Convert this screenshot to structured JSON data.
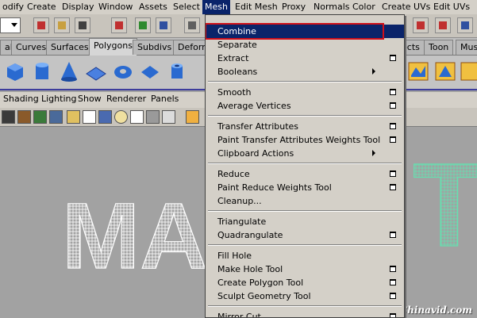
{
  "menubar": {
    "items": [
      "odify",
      "Create",
      "Display",
      "Window",
      "Assets",
      "Select",
      "Mesh",
      "Edit Mesh",
      "Proxy",
      "Normals",
      "Color",
      "Create UVs",
      "Edit UVs"
    ],
    "active_index": 6
  },
  "shelf_tabs": {
    "items": [
      "al",
      "Curves",
      "Surfaces",
      "Polygons",
      "Subdivs",
      "Deform",
      "ects",
      "Toon",
      "Mus"
    ],
    "active_index": 3
  },
  "panel_menu": {
    "items": [
      "Shading",
      "Lighting",
      "Show",
      "Renderer",
      "Panels"
    ]
  },
  "mesh_menu": {
    "items": [
      {
        "label": "Combine",
        "option": false,
        "submenu": false,
        "highlighted": true
      },
      {
        "label": "Separate",
        "option": false,
        "submenu": false
      },
      {
        "label": "Extract",
        "option": true,
        "submenu": false
      },
      {
        "label": "Booleans",
        "option": false,
        "submenu": true
      },
      {
        "separator": true
      },
      {
        "label": "Smooth",
        "option": true,
        "submenu": false
      },
      {
        "label": "Average Vertices",
        "option": true,
        "submenu": false
      },
      {
        "separator": true
      },
      {
        "label": "Transfer Attributes",
        "option": true,
        "submenu": false
      },
      {
        "label": "Paint Transfer Attributes Weights Tool",
        "option": true,
        "submenu": false
      },
      {
        "label": "Clipboard Actions",
        "option": false,
        "submenu": true
      },
      {
        "separator": true
      },
      {
        "label": "Reduce",
        "option": true,
        "submenu": false
      },
      {
        "label": "Paint Reduce Weights Tool",
        "option": true,
        "submenu": false
      },
      {
        "label": "Cleanup...",
        "option": false,
        "submenu": false
      },
      {
        "separator": true
      },
      {
        "label": "Triangulate",
        "option": false,
        "submenu": false
      },
      {
        "label": "Quadrangulate",
        "option": true,
        "submenu": false
      },
      {
        "separator": true
      },
      {
        "label": "Fill Hole",
        "option": false,
        "submenu": false
      },
      {
        "label": "Make Hole Tool",
        "option": true,
        "submenu": false
      },
      {
        "label": "Create Polygon Tool",
        "option": true,
        "submenu": false
      },
      {
        "label": "Sculpt Geometry Tool",
        "option": true,
        "submenu": false
      },
      {
        "separator": true
      },
      {
        "label": "Mirror Cut",
        "option": true,
        "submenu": false
      }
    ]
  },
  "viewport": {
    "text_left": "MAG",
    "text_right": "T",
    "wire_color_left": "#ffffff",
    "wire_color_right": "#66e0b0"
  },
  "watermark": "Chinavid.com",
  "colors": {
    "menu_bg": "#d4d0c8",
    "highlight": "#0a246a",
    "highlight_outline": "#d0101a",
    "viewport_bg": "#a2a2a2"
  }
}
